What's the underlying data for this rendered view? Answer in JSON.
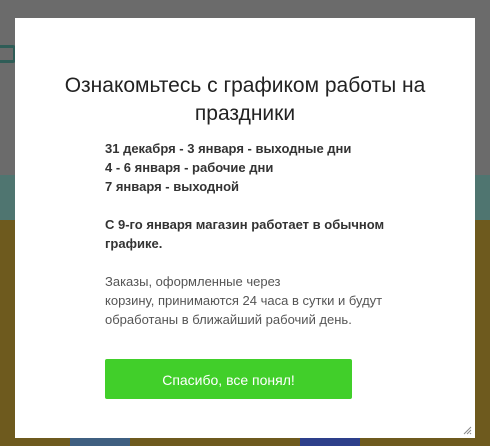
{
  "modal": {
    "title": "Ознакомьтесь с графиком работы на праздники",
    "schedule": [
      "31 декабря - 3 января - выходные дни",
      "4 - 6 января - рабочие дни",
      "7 января - выходной"
    ],
    "notice": "С 9-го января магазин работает в обычном графике.",
    "info_lines": [
      "Заказы, оформленные через",
      "корзину, принимаются 24 часа в сутки и будут",
      "обработаны в ближайший рабочий день."
    ],
    "button_label": "Спасибо, все понял!"
  },
  "colors": {
    "button": "#41cf2a",
    "overlay": "#5a5a5a",
    "modal_bg": "#ffffff"
  }
}
